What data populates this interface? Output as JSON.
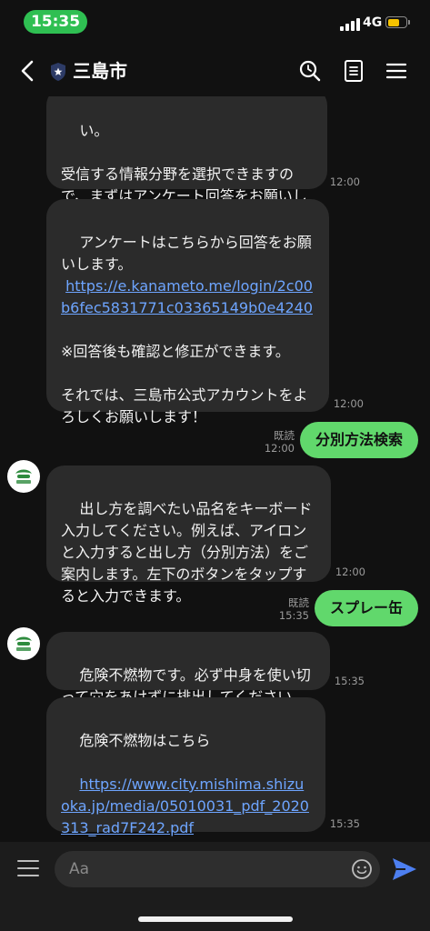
{
  "status": {
    "time": "15:35",
    "network": "4G",
    "battery_level": 0.7
  },
  "header": {
    "title": "三島市"
  },
  "messages": {
    "m1": {
      "text": "い。\n\n受信する情報分野を選択できますので、まずはアンケート回答をお願いします。",
      "time": "12:00"
    },
    "m2": {
      "text_before": "アンケートはこちらから回答をお願いします。\n ",
      "link": "https://e.kanameto.me/login/2c00b6fec5831771c03365149b0e4240",
      "text_after": "\n\n※回答後も確認と修正ができます。\n\nそれでは、三島市公式アカウントをよろしくお願いします！",
      "time": "12:00"
    },
    "s1": {
      "text": "分別方法検索",
      "read": "既読",
      "time": "12:00"
    },
    "m3": {
      "text": "出し方を調べたい品名をキーボード入力してください。例えば、アイロンと入力すると出し方（分別方法）をご案内します。左下のボタンをタップすると入力できます。",
      "time": "12:00"
    },
    "s2": {
      "text": "スプレー缶",
      "read": "既読",
      "time": "15:35"
    },
    "m4": {
      "text": "危険不燃物です。必ず中身を使い切って穴をあけずに排出してください。",
      "time": "15:35"
    },
    "m5": {
      "text": "危険不燃物はこちら",
      "link": "https://www.city.mishima.shizuoka.jp/media/05010031_pdf_2020313_rad7F242.pdf",
      "time": "15:35"
    }
  },
  "input": {
    "placeholder": "Aa"
  },
  "colors": {
    "sent_bubble": "#61d86c",
    "received_bubble": "#2b2b2b",
    "link": "#6ea5ff",
    "status_pill": "#2fbf52"
  }
}
